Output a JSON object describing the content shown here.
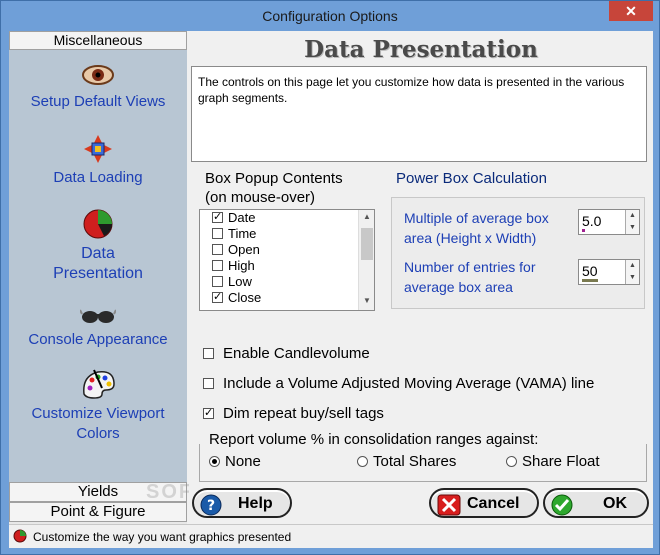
{
  "window": {
    "title": "Configuration Options",
    "close_glyph": "✕"
  },
  "nav": {
    "top_header": "Miscellaneous",
    "items": [
      {
        "label": "Setup Default Views",
        "icon": "eye-icon"
      },
      {
        "label": "Data Loading",
        "icon": "data-loading-icon"
      },
      {
        "label": "Data Presentation",
        "icon": "pie-icon",
        "active": true
      },
      {
        "label": "Console Appearance",
        "icon": "glasses-icon"
      },
      {
        "label": "Customize Viewport Colors",
        "icon": "palette-icon"
      }
    ],
    "bottom_headers": [
      "Yields",
      "Point & Figure"
    ]
  },
  "page": {
    "title": "Data Presentation",
    "description": "The controls on this page let you customize how data is presented in the various graph segments."
  },
  "box_popup": {
    "title_line1": "Box Popup Contents",
    "title_line2": "(on mouse-over)",
    "items": [
      {
        "label": "Date",
        "checked": true
      },
      {
        "label": "Time",
        "checked": false
      },
      {
        "label": "Open",
        "checked": false
      },
      {
        "label": "High",
        "checked": false
      },
      {
        "label": "Low",
        "checked": false
      },
      {
        "label": "Close",
        "checked": true
      }
    ]
  },
  "power_box": {
    "title": "Power Box Calculation",
    "multiple_label_line1": "Multiple of average box",
    "multiple_label_line2": "area (Height x Width)",
    "multiple_value": "5.0",
    "entries_label_line1": "Number of entries for",
    "entries_label_line2": "average box area",
    "entries_value": "50"
  },
  "options": {
    "enable_candlevolume": {
      "label": "Enable Candlevolume",
      "checked": false
    },
    "vama": {
      "label": "Include a Volume Adjusted Moving Average (VAMA) line",
      "checked": false
    },
    "dim_repeat": {
      "label": "Dim repeat buy/sell tags",
      "checked": true
    }
  },
  "report_volume": {
    "title": "Report volume % in consolidation ranges against:",
    "options": [
      {
        "label": "None",
        "selected": true
      },
      {
        "label": "Total Shares",
        "selected": false
      },
      {
        "label": "Share Float",
        "selected": false
      }
    ]
  },
  "buttons": {
    "help": "Help",
    "cancel": "Cancel",
    "ok": "OK"
  },
  "status_bar": {
    "text": "Customize the way you want graphics presented"
  },
  "watermark": "SOFTPEDIA",
  "colors": {
    "title_bar": "#6f9fd8",
    "nav_bg": "#b8c6d3",
    "nav_link": "#1d3fb5",
    "power_title": "#0a2a7a"
  }
}
